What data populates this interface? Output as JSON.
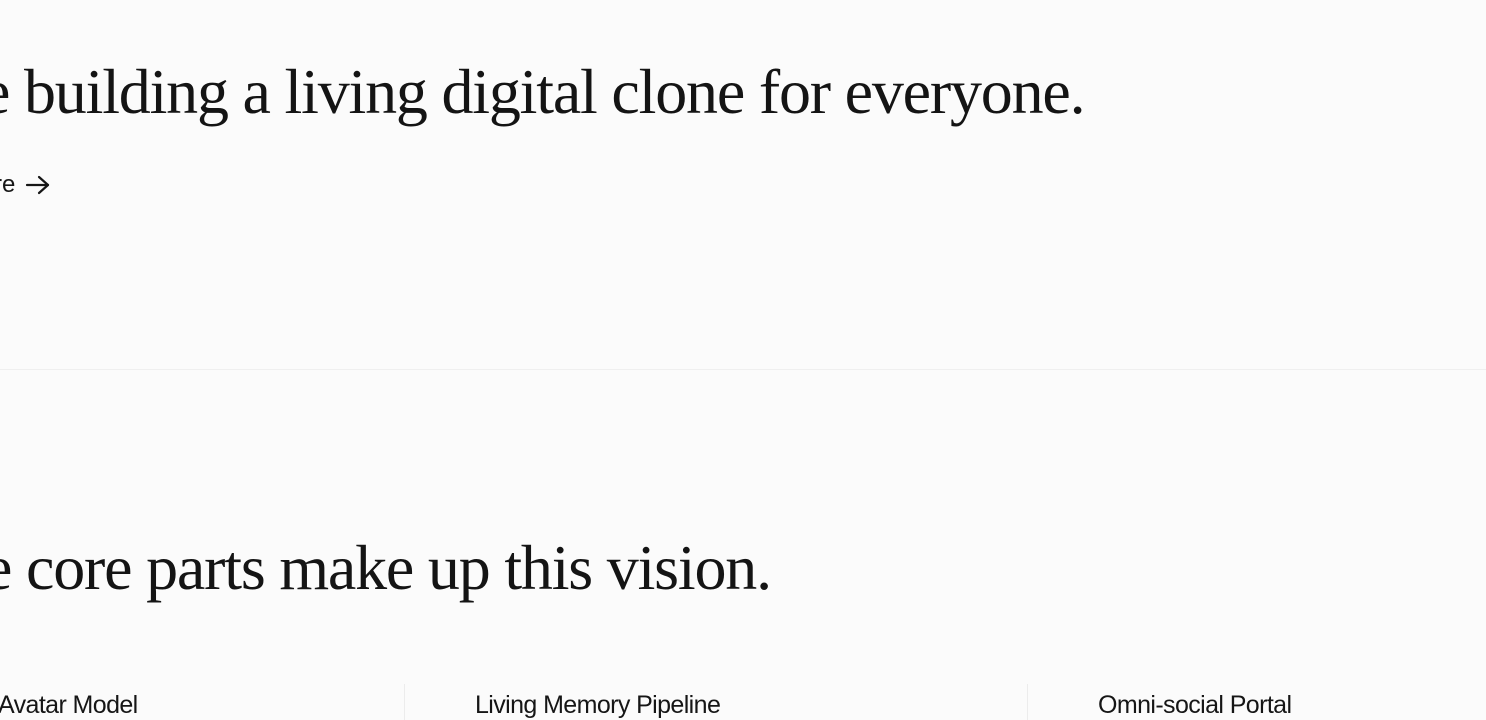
{
  "hero": {
    "headline": "e building a living digital clone for everyone.",
    "learn_more_label": "re",
    "learn_more_icon": "arrow-right-icon"
  },
  "vision": {
    "headline": "e core parts make up this vision."
  },
  "parts": [
    {
      "label": "Avatar Model"
    },
    {
      "label": "Living Memory Pipeline"
    },
    {
      "label": "Omni-social Portal"
    }
  ],
  "colors": {
    "background": "#fbfbfb",
    "text": "#141414",
    "divider": "#efefef"
  }
}
